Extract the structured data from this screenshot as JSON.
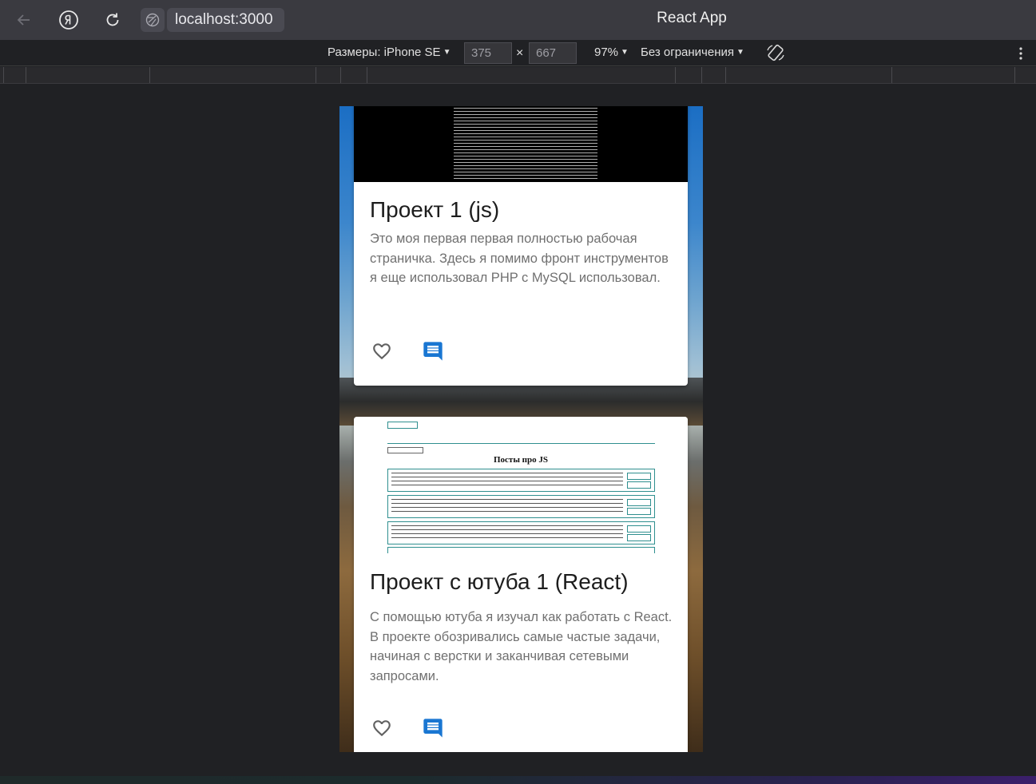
{
  "browser": {
    "url": "localhost:3000",
    "page_title": "React App"
  },
  "devtools": {
    "device_label": "Размеры: iPhone SE",
    "width_value": "375",
    "height_value": "667",
    "times_sign": "×",
    "zoom_label": "97%",
    "throttle_label": "Без ограничения"
  },
  "cards": [
    {
      "title": "Проект 1 (js)",
      "description": "Это моя первая первая полностью рабочая страничка. Здесь я помимо фронт инструментов я еще использовал PHP с MySQL использовал."
    },
    {
      "title": "Проект с ютуба 1 (React)",
      "description": "С помощью ютуба я изучал как работать с React. В проекте обозривались самые частые задачи, начиная с верстки и заканчивая сетевыми запросами.",
      "thumbnail_heading": "Посты про JS"
    }
  ],
  "colors": {
    "accent_blue": "#1976d2",
    "icon_grey": "#616161"
  },
  "icons": [
    "back-arrow-icon",
    "yandex-icon",
    "reload-icon",
    "site-info-icon",
    "rotate-icon",
    "more-vert-icon",
    "favorite-border-icon",
    "comment-icon"
  ]
}
